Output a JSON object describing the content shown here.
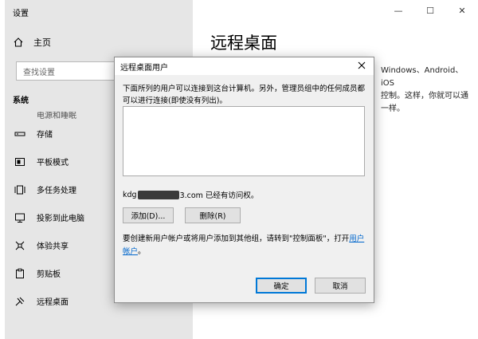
{
  "window": {
    "title": "设置",
    "minimize": "—",
    "maximize": "☐",
    "close": "✕"
  },
  "sidebar": {
    "home_label": "主页",
    "search_placeholder": "查找设置",
    "group_label": "系统",
    "items": [
      {
        "label": "电源和睡眠",
        "icon": "power-icon"
      },
      {
        "label": "存储",
        "icon": "storage-icon"
      },
      {
        "label": "平板模式",
        "icon": "tablet-icon"
      },
      {
        "label": "多任务处理",
        "icon": "multitask-icon"
      },
      {
        "label": "投影到此电脑",
        "icon": "project-icon"
      },
      {
        "label": "体验共享",
        "icon": "share-icon"
      },
      {
        "label": "剪贴板",
        "icon": "clipboard-icon"
      },
      {
        "label": "远程桌面",
        "icon": "remote-desktop-icon"
      }
    ]
  },
  "main": {
    "title": "远程桌面",
    "desc_lines": [
      "Windows、Android、iOS",
      "控制。这样，你就可以通",
      "一样。"
    ]
  },
  "dialog": {
    "title": "远程桌面用户",
    "description": "下面所列的用户可以连接到这台计算机。另外，管理员组中的任何成员都可以进行连接(即使没有列出)。",
    "account_prefix": "kdg",
    "account_suffix": "3.com 已经有访问权。",
    "add_button": "添加(D)...",
    "remove_button": "删除(R)",
    "note_prefix": "要创建新用户帐户或将用户添加到其他组，请转到\"控制面板\"，打开",
    "note_link": "用户帐户",
    "note_end": "。",
    "ok_button": "确定",
    "cancel_button": "取消"
  }
}
